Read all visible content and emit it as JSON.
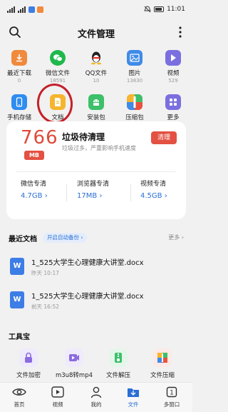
{
  "status_bar": {
    "left_text": "46 ⁴⁶ ¹⁶",
    "time": "11:01"
  },
  "header": {
    "title": "文件管理"
  },
  "categories": [
    {
      "label": "最近下载",
      "count": "0",
      "icon": "download-icon",
      "color": "#f08a3c"
    },
    {
      "label": "微信文件",
      "count": "18591",
      "icon": "wechat-icon",
      "color": "#1fb84c"
    },
    {
      "label": "QQ文件",
      "count": "10",
      "icon": "qq-icon",
      "color": "#ffffff"
    },
    {
      "label": "图片",
      "count": "13830",
      "icon": "image-icon",
      "color": "#3f8be8"
    },
    {
      "label": "视频",
      "count": "529",
      "icon": "video-icon",
      "color": "#7b6fe0"
    },
    {
      "label": "手机存储",
      "count": "",
      "icon": "phone-storage-icon",
      "color": "#2f8cf0"
    },
    {
      "label": "文档",
      "count": "223",
      "icon": "document-icon",
      "color": "#f5b52e"
    },
    {
      "label": "安装包",
      "count": "2",
      "icon": "apk-icon",
      "color": "#3cc06a"
    },
    {
      "label": "压缩包",
      "count": "44",
      "icon": "archive-icon",
      "color": "#e8523f"
    },
    {
      "label": "更多",
      "count": "",
      "icon": "more-grid-icon",
      "color": "#7b6fe0"
    }
  ],
  "cleanup": {
    "size": "766",
    "unit": "MB",
    "title": "垃圾待清理",
    "subtitle": "垃圾过多，严重影响手机速度",
    "button": "清理",
    "items": [
      {
        "label": "微信专清",
        "size": "4.7GB"
      },
      {
        "label": "浏览器专清",
        "size": "17MB"
      },
      {
        "label": "视频专清",
        "size": "4.5GB"
      }
    ]
  },
  "recent": {
    "title": "最近文档",
    "auto_backup": "开启自动备份",
    "more": "更多",
    "docs": [
      {
        "name": "1_525大学生心理健康大讲堂.docx",
        "time": "昨天 10:17"
      },
      {
        "name": "1_525大学生心理健康大讲堂.docx",
        "time": "前天 16:52"
      }
    ]
  },
  "toolbox": {
    "title": "工具宝",
    "items": [
      {
        "label": "文件加密",
        "icon": "lock-icon",
        "color": "#8b6be0"
      },
      {
        "label": "m3u8转mp4",
        "icon": "convert-video-icon",
        "color": "#8b6be0"
      },
      {
        "label": "文件解压",
        "icon": "unzip-icon",
        "color": "#3cc06a"
      },
      {
        "label": "文件压缩",
        "icon": "zip-icon",
        "color": "#e8523f"
      }
    ]
  },
  "bottom_nav": [
    {
      "label": "首页",
      "icon": "eye-icon"
    },
    {
      "label": "视频",
      "icon": "video-play-icon"
    },
    {
      "label": "我的",
      "icon": "person-icon"
    },
    {
      "label": "文件",
      "icon": "folder-icon"
    },
    {
      "label": "多窗口",
      "icon": "window-count-icon",
      "badge": "1"
    }
  ],
  "colors": {
    "accent_blue": "#2a6fd6",
    "danger_red": "#e35142"
  }
}
